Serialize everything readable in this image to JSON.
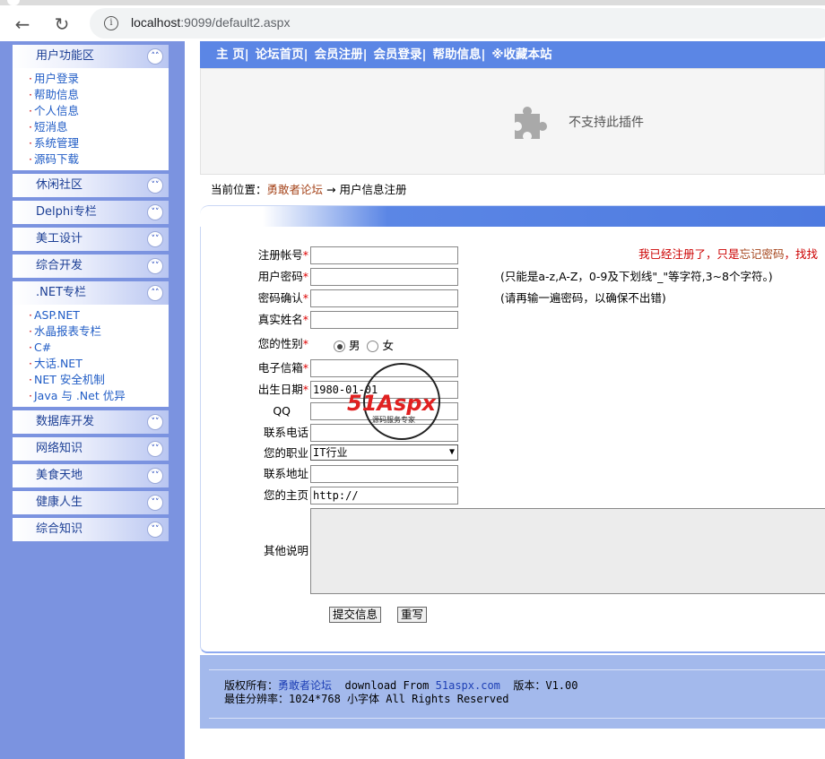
{
  "browser": {
    "url_host": "localhost",
    "url_rest": ":9099/default2.aspx"
  },
  "sidebar": {
    "sections": [
      {
        "label": "用户功能区",
        "open": true,
        "items": [
          "用户登录",
          "帮助信息",
          "个人信息",
          "短消息",
          "系统管理",
          "源码下载"
        ]
      },
      {
        "label": "休闲社区",
        "open": false,
        "items": []
      },
      {
        "label": "Delphi专栏",
        "open": false,
        "items": []
      },
      {
        "label": "美工设计",
        "open": false,
        "items": []
      },
      {
        "label": "综合开发",
        "open": false,
        "items": []
      },
      {
        "label": ".NET专栏",
        "open": true,
        "items": [
          "ASP.NET",
          "水晶报表专栏",
          "C#",
          "大话.NET",
          "NET 安全机制",
          "Java 与 .Net 优异"
        ]
      },
      {
        "label": "数据库开发",
        "open": false,
        "items": []
      },
      {
        "label": "网络知识",
        "open": false,
        "items": []
      },
      {
        "label": "美食天地",
        "open": false,
        "items": []
      },
      {
        "label": "健康人生",
        "open": false,
        "items": []
      },
      {
        "label": "综合知识",
        "open": false,
        "items": []
      }
    ]
  },
  "topnav": [
    "主 页|",
    "论坛首页|",
    "会员注册|",
    "会员登录|",
    "帮助信息|",
    "※收藏本站"
  ],
  "plugin_text": "不支持此插件",
  "breadcrumb": {
    "prefix": "当前位置：",
    "link": "勇敢者论坛",
    "arrow": "→",
    "current": "用户信息注册"
  },
  "form": {
    "right_note_prefix": "我已经注册了，只是",
    "right_note_link": "忘记密码",
    "right_note_suffix": "，找找",
    "labels": {
      "account": "注册帐号",
      "password": "用户密码",
      "confirm": "密码确认",
      "realname": "真实姓名",
      "gender": "您的性别",
      "email": "电子信箱",
      "birthday": "出生日期",
      "qq": "QQ",
      "phone": "联系电话",
      "job": "您的职业",
      "address": "联系地址",
      "homepage": "您的主页",
      "remarks": "其他说明"
    },
    "required_mark": "*",
    "hint_password": "(只能是a-z,A-Z，0-9及下划线\"_\"等字符,3~8个字符。)",
    "hint_confirm": "(请再输一遍密码，以确保不出错)",
    "gender_male": "男",
    "gender_female": "女",
    "gender_selected": "男",
    "birthday_value": "1980-01-01",
    "job_value": "IT行业",
    "homepage_value": "http://",
    "submit_label": "提交信息",
    "reset_label": "重写"
  },
  "footer": {
    "copyright_prefix": "版权所有：",
    "copyright_link": "勇敢者论坛",
    "download_prefix": "download From ",
    "download_link": "51aspx.com",
    "version": "版本：V1.00",
    "line2": "最佳分辨率：1024*768   小字体 All Rights Reserved"
  },
  "watermark": {
    "text": "51Aspx",
    "sub": "源码服务专家"
  },
  "colors": {
    "sidebar_bg": "#7b93e0",
    "topnav_bg": "#5b86e5",
    "footer_bg": "#a3b9ec",
    "link": "#a6461d",
    "required": "#dd0000"
  }
}
